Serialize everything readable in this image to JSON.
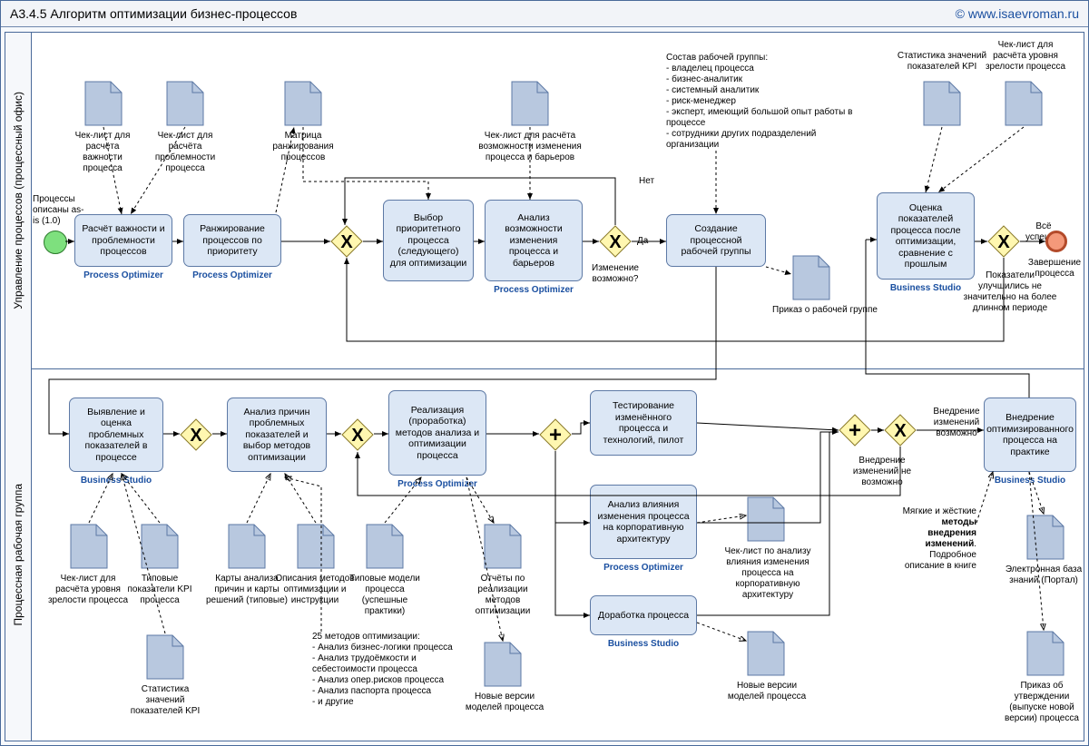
{
  "titlebar": {
    "title": "А3.4.5 Алгоритм оптимизации бизнес-процессов",
    "copyright": "© www.isaevroman.ru"
  },
  "lanes": {
    "top": "Управление процессов (процессный офис)",
    "bottom": "Процессная рабочая группа"
  },
  "start_label": "Процессы описаны as-is (1.0)",
  "end_label": "Завершение процесса",
  "top_tasks": {
    "t1": "Расчёт важности и проблемности процессов",
    "t2": "Ранжирование процессов по приоритету",
    "t3": "Выбор приоритетного процесса (следующего) для оптимизации",
    "t4": "Анализ возможности изменения процесса и барьеров",
    "t5": "Создание процессной рабочей группы",
    "t6": "Оценка показателей процесса после оптимизации, сравнение с прошлым"
  },
  "top_roles": {
    "r1": "Process Optimizer",
    "r2": "Process Optimizer",
    "r4": "Process Optimizer",
    "r6": "Business Studio"
  },
  "top_docs": {
    "d1": "Чек-лист для расчёта важности процесса",
    "d2": "Чек-лист для расчёта проблемности процесса",
    "d3": "Матрица ранжирования процессов",
    "d4": "Чек-лист для расчёта возможности изменения процесса и барьеров",
    "d5": "Статистика значений показателей KPI",
    "d6": "Чек-лист для расчёта уровня зрелости процесса",
    "d7": "Приказ о рабочей группе"
  },
  "gw1_label": "Изменение возможно?",
  "gw1_yes": "Да",
  "gw1_no": "Нет",
  "gw_end_yes": "Всё успешно",
  "gw_end_no": "Показатели улучшились не значительно на более длинном периоде",
  "group_note_title": "Состав рабочей группы:",
  "group_note_lines": [
    "- владелец процесса",
    "- бизнес-аналитик",
    "- системный аналитик",
    "- риск-менеджер",
    "- эксперт, имеющий большой опыт работы в  процессе",
    "- сотрудники других подразделений организации"
  ],
  "bot_tasks": {
    "b1": "Выявление и оценка проблемных показателей в процессе",
    "b2": "Анализ причин проблемных показателей и выбор методов оптимизации",
    "b3": "Реализация (проработка) методов анализа и оптимизации процесса",
    "b4": "Тестирование изменённого процесса и технологий, пилот",
    "b5": "Анализ влияния изменения процесса на корпоративную архитектуру",
    "b6": "Доработка процесса",
    "b7": "Внедрение оптимизированного процесса на практике"
  },
  "bot_roles": {
    "rb1": "Business Studio",
    "rb3": "Process Optimizer",
    "rb5": "Process Optimizer",
    "rb6": "Business Studio",
    "rb7": "Business Studio"
  },
  "bot_docs": {
    "bd1": "Чек-лист для расчёта уровня зрелости процесса",
    "bd2": "Типовые показатели KPI процесса",
    "bd3": "Статистика значений показателей KPI",
    "bd4": "Карты анализа причин и карты решений (типовые)",
    "bd5": "Описания методов оптимизации и инструкции",
    "bd6": "Типовые модели процесса (успешные практики)",
    "bd7": "Отчёты по реализации методов оптимизации",
    "bd8": "Новые версии моделей процесса",
    "bd9": "Чек-лист по анализу влияния изменения процесса на корпоративную архитектуру",
    "bd10": "Новые версии моделей процесса",
    "bd11": "Электронная база знаний (Портал)",
    "bd12": "Приказ об утверждении (выпуске новой версии) процесса"
  },
  "gw2_label": "Внедрение изменений возможно",
  "gw2_no": "Внедрение изменений не возможно",
  "methods_note_title": "25 методов оптимизации:",
  "methods_lines": [
    "- Анализ бизнес-логики процесса",
    "- Анализ трудоёмкости и себестоимости процесса",
    "- Анализ опер.рисков процесса",
    "- Анализ паспорта процесса",
    "- и другие"
  ],
  "impl_note": "Мягкие и жёсткие методы внедрения изменений. Подробное описание в книге",
  "impl_note_bold1": "методы",
  "impl_note_bold2": "внедрения",
  "impl_note_bold3": "изменений"
}
